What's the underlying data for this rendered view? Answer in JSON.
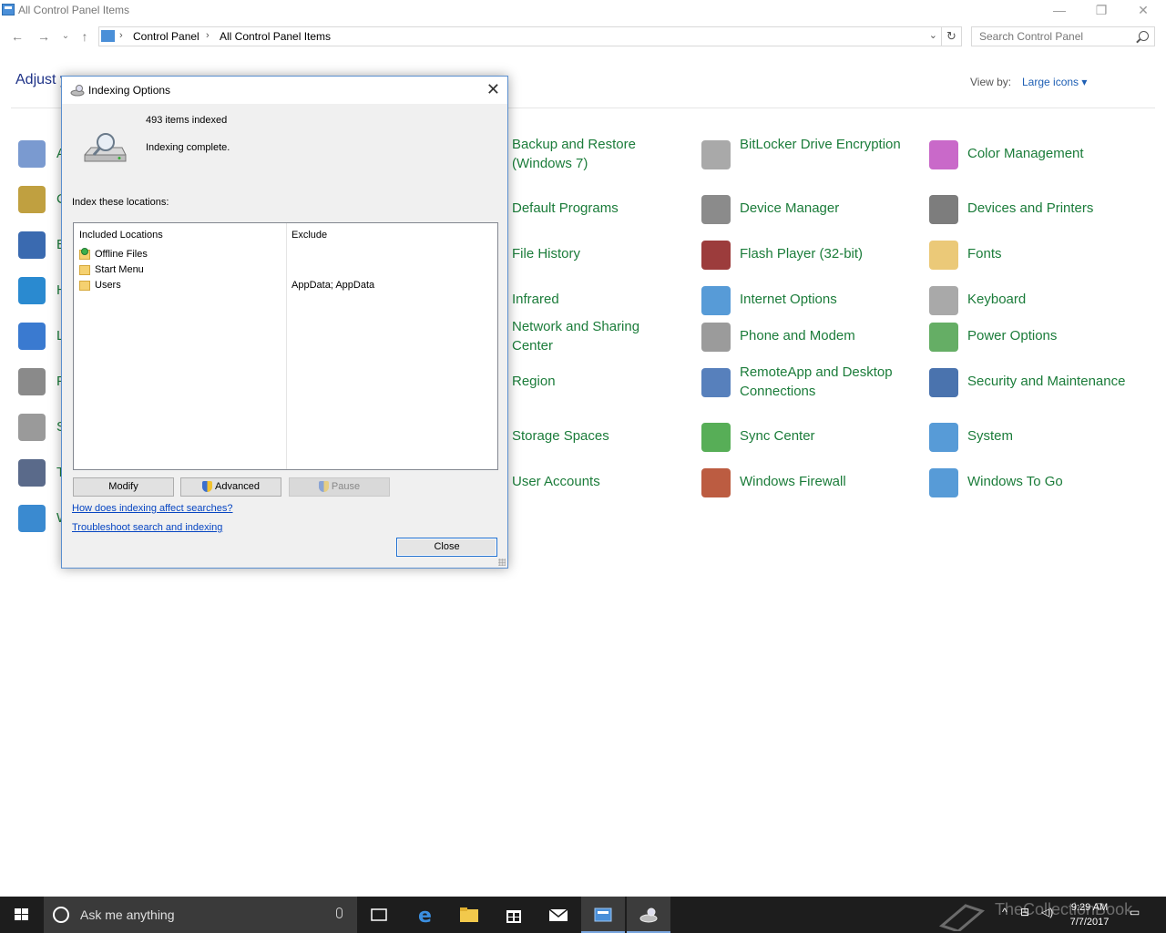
{
  "window": {
    "title": "All Control Panel Items",
    "breadcrumb": [
      "Control Panel",
      "All Control Panel Items"
    ],
    "search_placeholder": "Search Control Panel",
    "heading": "Adjust y",
    "view_by_label": "View by:",
    "view_by_value": "Large icons ▾"
  },
  "left_items": [
    "A",
    "C",
    "E",
    "H",
    "L",
    "P",
    "S",
    "T",
    "W"
  ],
  "items": [
    {
      "label": "Backup and Restore (Windows 7)",
      "icon": "backup-icon",
      "color": "#5aa05a"
    },
    {
      "label": "BitLocker Drive Encryption",
      "icon": "bitlocker-icon",
      "color": "#9a9a9a"
    },
    {
      "label": "Color Management",
      "icon": "color-management-icon",
      "color": "#c04fc0"
    },
    {
      "label": "Default Programs",
      "icon": "default-programs-icon",
      "color": "#5a9a5a"
    },
    {
      "label": "Device Manager",
      "icon": "device-manager-icon",
      "color": "#777777"
    },
    {
      "label": "Devices and Printers",
      "icon": "printer-icon",
      "color": "#666666"
    },
    {
      "label": "File History",
      "icon": "file-history-icon",
      "color": "#e0b040"
    },
    {
      "label": "Flash Player (32-bit)",
      "icon": "flash-icon",
      "color": "#8b1a1a"
    },
    {
      "label": "Fonts",
      "icon": "fonts-icon",
      "color": "#e8c060"
    },
    {
      "label": "Infrared",
      "icon": "infrared-icon",
      "color": "#777777"
    },
    {
      "label": "Internet Options",
      "icon": "internet-options-icon",
      "color": "#3a8ad0"
    },
    {
      "label": "Keyboard",
      "icon": "keyboard-icon",
      "color": "#9a9a9a"
    },
    {
      "label": "Network and Sharing Center",
      "icon": "network-icon",
      "color": "#3a7ad0"
    },
    {
      "label": "Phone and Modem",
      "icon": "phone-icon",
      "color": "#8a8a8a"
    },
    {
      "label": "Power Options",
      "icon": "power-icon",
      "color": "#4aa04a"
    },
    {
      "label": "Region",
      "icon": "region-icon",
      "color": "#3a7ad0"
    },
    {
      "label": "RemoteApp and Desktop Connections",
      "icon": "remoteapp-icon",
      "color": "#3a6ab0"
    },
    {
      "label": "Security and Maintenance",
      "icon": "flag-icon",
      "color": "#2a5aa0"
    },
    {
      "label": "Storage Spaces",
      "icon": "storage-icon",
      "color": "#888888"
    },
    {
      "label": "Sync Center",
      "icon": "sync-icon",
      "color": "#3aa03a"
    },
    {
      "label": "System",
      "icon": "system-icon",
      "color": "#3a8ad0"
    },
    {
      "label": "User Accounts",
      "icon": "user-icon",
      "color": "#3a8ad0"
    },
    {
      "label": "Windows Firewall",
      "icon": "firewall-icon",
      "color": "#b04020"
    },
    {
      "label": "Windows To Go",
      "icon": "windows-to-go-icon",
      "color": "#3a8ad0"
    }
  ],
  "dialog": {
    "title": "Indexing Options",
    "count": "493 items indexed",
    "status": "Indexing complete.",
    "locations_label": "Index these locations:",
    "col_included": "Included Locations",
    "col_exclude": "Exclude",
    "rows": [
      {
        "name": "Offline Files",
        "exclude": ""
      },
      {
        "name": "Start Menu",
        "exclude": ""
      },
      {
        "name": "Users",
        "exclude": "AppData; AppData"
      }
    ],
    "btn_modify": "Modify",
    "btn_advanced": "Advanced",
    "btn_pause": "Pause",
    "link_affect": "How does indexing affect searches?",
    "link_troubleshoot": "Troubleshoot search and indexing",
    "btn_close": "Close"
  },
  "taskbar": {
    "search_text": "Ask me anything",
    "time": "9:29 AM",
    "date": "7/7/2017",
    "watermark": "TheCollectionBook"
  }
}
